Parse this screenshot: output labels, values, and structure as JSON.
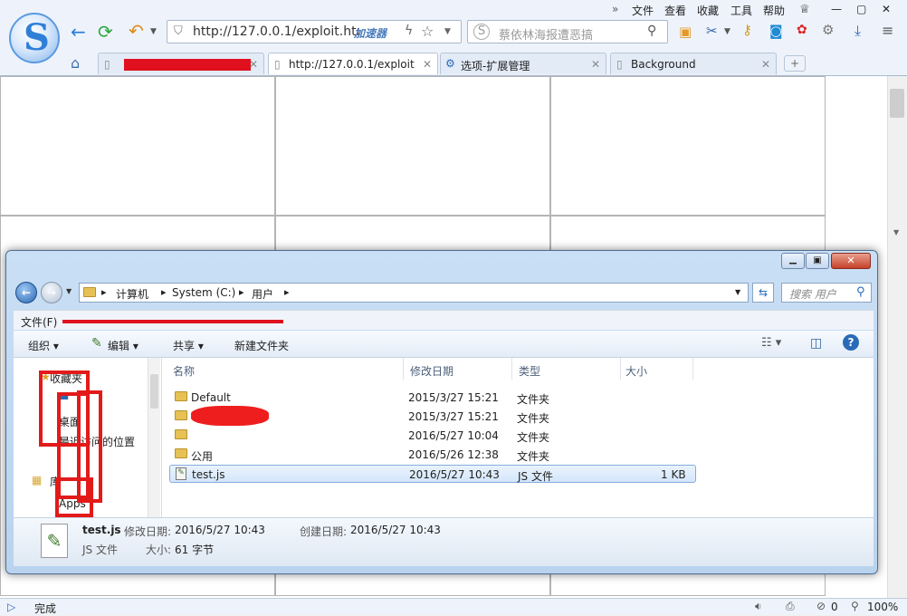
{
  "browser": {
    "menu": [
      "文件",
      "查看",
      "收藏",
      "工具",
      "帮助"
    ],
    "url": "http://127.0.0.1/exploit.htı",
    "accelerator": "加速器",
    "search_placeholder": "蔡依林海报遭恶搞",
    "tabs": [
      {
        "label": "",
        "active": false
      },
      {
        "label": "http://127.0.0.1/exploit",
        "active": true
      },
      {
        "label": "选项-扩展管理",
        "active": false
      },
      {
        "label": "Background",
        "active": false
      }
    ],
    "status": "完成",
    "status_count": "0",
    "zoom": "100%"
  },
  "explorer": {
    "breadcrumb": [
      "计算机",
      "System (C:)",
      "用户"
    ],
    "search_placeholder": "搜索 用户",
    "menu_file": "文件(F)",
    "toolbar": {
      "organize": "组织",
      "edit": "编辑",
      "share": "共享",
      "new_folder": "新建文件夹"
    },
    "nav": {
      "favorites": "收藏夹",
      "desktop": "桌面",
      "recent": "最近访问的位置",
      "library": "库",
      "apps": "Apps"
    },
    "columns": {
      "name": "名称",
      "date": "修改日期",
      "type": "类型",
      "size": "大小"
    },
    "files": [
      {
        "name": "Default",
        "date": "2015/3/27 15:21",
        "type": "文件夹",
        "size": ""
      },
      {
        "name": "",
        "date": "2015/3/27 15:21",
        "type": "文件夹",
        "size": ""
      },
      {
        "name": "",
        "date": "2016/5/27 10:04",
        "type": "文件夹",
        "size": ""
      },
      {
        "name": "公用",
        "date": "2016/5/26 12:38",
        "type": "文件夹",
        "size": ""
      },
      {
        "name": "test.js",
        "date": "2016/5/27 10:43",
        "type": "JS 文件",
        "size": "1 KB"
      }
    ],
    "details": {
      "filename": "test.js",
      "modified_label": "修改日期:",
      "modified": "2016/5/27 10:43",
      "created_label": "创建日期:",
      "created": "2016/5/27 10:43",
      "type": "JS 文件",
      "size_label": "大小:",
      "size": "61 字节"
    }
  }
}
